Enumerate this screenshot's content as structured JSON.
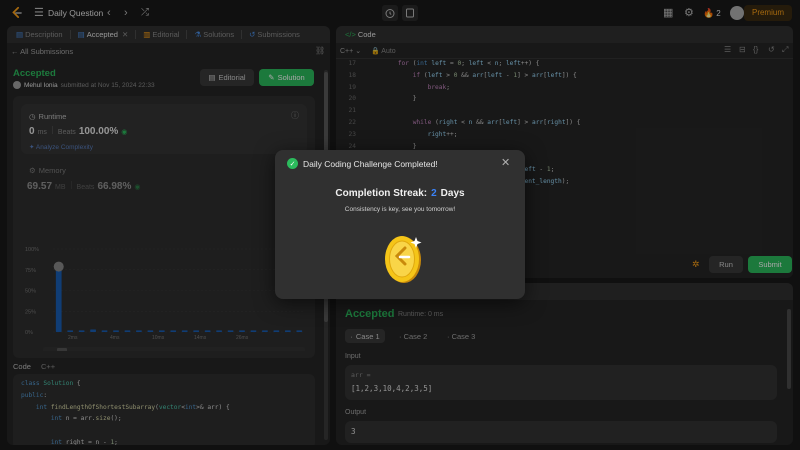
{
  "topbar": {
    "title": "Daily Question",
    "streak_count": "2",
    "premium": "Premium"
  },
  "left_tabs": {
    "description": "Description",
    "accepted": "Accepted",
    "editorial": "Editorial",
    "solutions": "Solutions",
    "submissions": "Submissions"
  },
  "submission": {
    "back": "All Submissions",
    "status": "Accepted",
    "user": "Mehul Ionia",
    "submitted_at": "submitted at Nov 15, 2024 22:33",
    "editorial_btn": "Editorial",
    "solution_btn": "Solution"
  },
  "runtime": {
    "title": "Runtime",
    "value": "0",
    "unit": "ms",
    "beats_label": "Beats",
    "beats": "100.00%",
    "analyze": "Analyze Complexity"
  },
  "memory": {
    "title": "Memory",
    "value": "69.57",
    "unit": "MB",
    "beats_label": "Beats",
    "beats": "66.98%"
  },
  "chart_data": {
    "type": "bar",
    "yticks": [
      "100%",
      "75%",
      "50%",
      "25%",
      "0%"
    ],
    "ylim": [
      0,
      100
    ],
    "xticks": [
      "2ms",
      "4ms",
      "10ms",
      "14ms",
      "26ms"
    ],
    "values": [
      74,
      2,
      2,
      3,
      2,
      2,
      2,
      2,
      2,
      2,
      2,
      2,
      2,
      2,
      2,
      2,
      2,
      2,
      2,
      2,
      2,
      2
    ],
    "minimap_ticks": [
      "2ms",
      "4ms",
      "10ms",
      "14ms",
      "26ms"
    ]
  },
  "code_section": {
    "label": "Code",
    "lang": "C++",
    "lines": [
      "class Solution {",
      "public:",
      "    int findLengthOfShortestSubarray(vector<int>& arr) {",
      "        int n = arr.size();",
      "",
      "        int right = n - 1;"
    ]
  },
  "editor": {
    "tab": "Code",
    "lang": "C++",
    "auto": "Auto",
    "line_numbers": [
      "17",
      "18",
      "19",
      "20",
      "21",
      "22",
      "23",
      "24",
      "25",
      "26",
      "27"
    ],
    "lines": [
      "        for (int left = 0; left < n; left++) {",
      "            if (left > 0 && arr[left - 1] > arr[left]) {",
      "                break;",
      "            }",
      "",
      "            while (right < n && arr[left] > arr[right]) {",
      "                right++;",
      "            }",
      "",
      "            int current_length = right - left - 1;",
      "                                      current_length);"
    ],
    "run": "Run",
    "submit": "Submit"
  },
  "result": {
    "status": "Accepted",
    "runtime": "Runtime: 0 ms",
    "cases": [
      "Case 1",
      "Case 2",
      "Case 3"
    ],
    "input_label": "Input",
    "input_var": "arr =",
    "input_value": "[1,2,3,10,4,2,3,5]",
    "output_label": "Output",
    "output_value": "3"
  },
  "modal": {
    "title": "Daily Coding Challenge Completed!",
    "streak_label": "Completion Streak:",
    "streak_value": "2",
    "streak_unit": "Days",
    "message": "Consistency is key, see you tomorrow!"
  },
  "colors": {
    "accent_green": "#2cbb5d",
    "accent_orange": "#ffa116",
    "bar_blue": "#1a5fb4",
    "streak_blue": "#3b82f6"
  }
}
